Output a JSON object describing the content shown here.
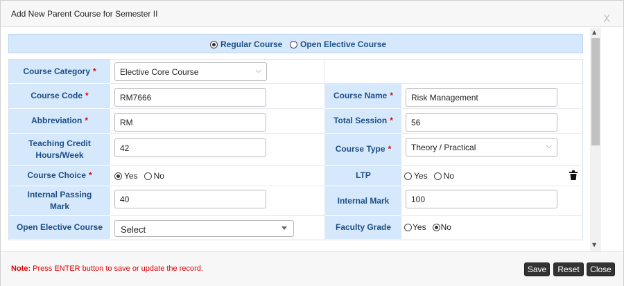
{
  "dialog": {
    "title": "Add New Parent Course for Semester II",
    "close_glyph": "X"
  },
  "course_type_options": [
    {
      "label": "Regular Course",
      "selected": true
    },
    {
      "label": "Open Elective Course",
      "selected": false
    }
  ],
  "form": {
    "course_category": {
      "label": "Course Category",
      "required": "*",
      "value": "Elective Core Course"
    },
    "course_code": {
      "label": "Course Code",
      "required": "*",
      "value": "RM7666"
    },
    "course_name": {
      "label": "Course Name",
      "required": "*",
      "value": "Risk Management"
    },
    "abbreviation": {
      "label": "Abbreviation",
      "required": "*",
      "value": "RM"
    },
    "total_session": {
      "label": "Total Session",
      "required": "*",
      "value": "56"
    },
    "teaching_credit": {
      "label": "Teaching Credit Hours/Week",
      "value": "42"
    },
    "course_type": {
      "label": "Course Type",
      "required": "*",
      "value": "Theory / Practical"
    },
    "course_choice": {
      "label": "Course Choice",
      "required": "*",
      "options": [
        "Yes",
        "No"
      ],
      "selected": "Yes"
    },
    "ltp": {
      "label": "LTP",
      "options": [
        "Yes",
        "No"
      ],
      "selected": ""
    },
    "internal_passing": {
      "label": "Internal Passing Mark",
      "value": "40"
    },
    "internal_mark": {
      "label": "Internal Mark",
      "value": "100"
    },
    "open_elective": {
      "label": "Open Elective Course",
      "value": "Select"
    },
    "faculty_grade": {
      "label": "Faculty Grade",
      "options": [
        "Yes",
        "No"
      ],
      "selected": "No"
    }
  },
  "footer": {
    "note_prefix": "Note:",
    "note_text": " Press ENTER button to save or update the record.",
    "buttons": {
      "save": "Save",
      "reset": "Reset",
      "close": "Close"
    }
  },
  "icons": {
    "delete": "trash-icon",
    "dropdown": "chevron-down-icon",
    "scroll_up": "chevron-up-icon",
    "scroll_down": "chevron-down-icon"
  },
  "colors": {
    "label_bg": "#d6e8fb",
    "label_text": "#1d4f86",
    "required": "#e10000",
    "button_bg": "#333333"
  }
}
